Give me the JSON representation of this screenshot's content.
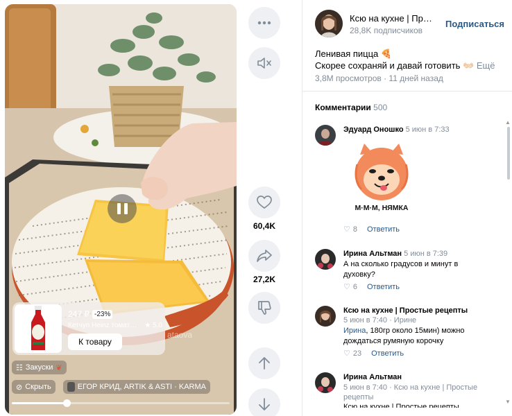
{
  "video": {
    "watermark": "ataova",
    "product": {
      "price": "247 ₽",
      "discount": "-23%",
      "name": "Кетчуп Heinz томат…",
      "rating": "5,0",
      "button_label": "К товару"
    },
    "chips": {
      "category": "Закуски",
      "hide": "Скрыть",
      "music": "ЕГОР КРИД, ARTIK & ASTI · KARMA"
    },
    "progress": 0.25
  },
  "actions": {
    "likes": "60,4K",
    "shares": "27,2K"
  },
  "author": {
    "name": "Ксю на кухне | Про…",
    "subscribers": "28,8K подписчиков",
    "subscribe_label": "Подписаться"
  },
  "post": {
    "title": "Ленивая пицца 🍕",
    "text": "Скорее сохраняй и давай готовить ",
    "more": "Ещё",
    "views": "3,8M просмотров",
    "age": "11 дней назад"
  },
  "comments": {
    "title": "Комментарии",
    "count": "500",
    "reply_label": "Ответить",
    "sticker_text": "М·М·М, НЯМКА",
    "items": [
      {
        "author": "Эдуард Оношко",
        "date": "5 июн в 7:33",
        "likes": "8"
      },
      {
        "author": "Ирина Альтман",
        "date": "5 июн в 7:39",
        "text": "А на сколько градусов и минут в духовку?",
        "likes": "6"
      },
      {
        "author": "Ксю на кухне | Простые рецепты",
        "date": "5 июн в 7:40",
        "reply_to": "Ирине",
        "mention": "Ирина",
        "text": ", 180гр около 15мин) можно дождаться румяную корочку",
        "likes": "23"
      },
      {
        "author": "Ирина Альтман",
        "date": "5 июн в 7:40",
        "reply_to": "Ксю на кухне | Простые рецепты",
        "text": "Ксю на кухне | Простые рецепты"
      }
    ]
  }
}
